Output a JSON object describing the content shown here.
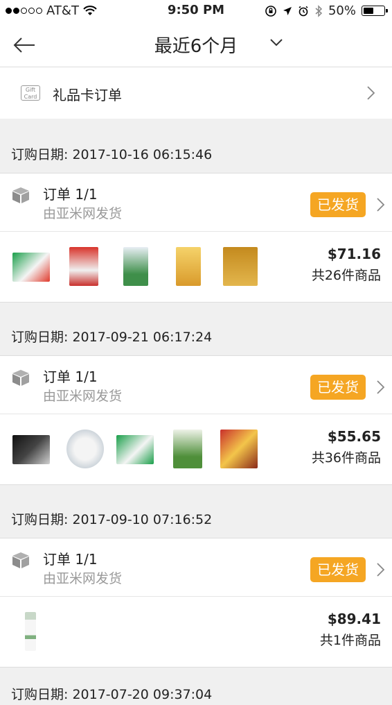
{
  "status": {
    "carrier": "AT&T",
    "time": "9:50 PM",
    "battery": "50%"
  },
  "nav": {
    "title": "最近6个月"
  },
  "gift_card": {
    "label": "礼品卡订单",
    "icon_text": "Gift Card"
  },
  "orders": [
    {
      "date": "订购日期: 2017-10-16 06:15:46",
      "order_no": "订单 1/1",
      "shipper": "由亚米网发货",
      "status": "已发货",
      "price": "$71.16",
      "count": "共26件商品"
    },
    {
      "date": "订购日期: 2017-09-21 06:17:24",
      "order_no": "订单 1/1",
      "shipper": "由亚米网发货",
      "status": "已发货",
      "price": "$55.65",
      "count": "共36件商品"
    },
    {
      "date": "订购日期: 2017-09-10 07:16:52",
      "order_no": "订单 1/1",
      "shipper": "由亚米网发货",
      "status": "已发货",
      "price": "$89.41",
      "count": "共1件商品"
    }
  ],
  "partial_date": "订购日期: 2017-07-20 09:37:04",
  "colors": {
    "badge": "#f5a623",
    "secondary_text": "#999999",
    "background": "#f0f0f0"
  }
}
